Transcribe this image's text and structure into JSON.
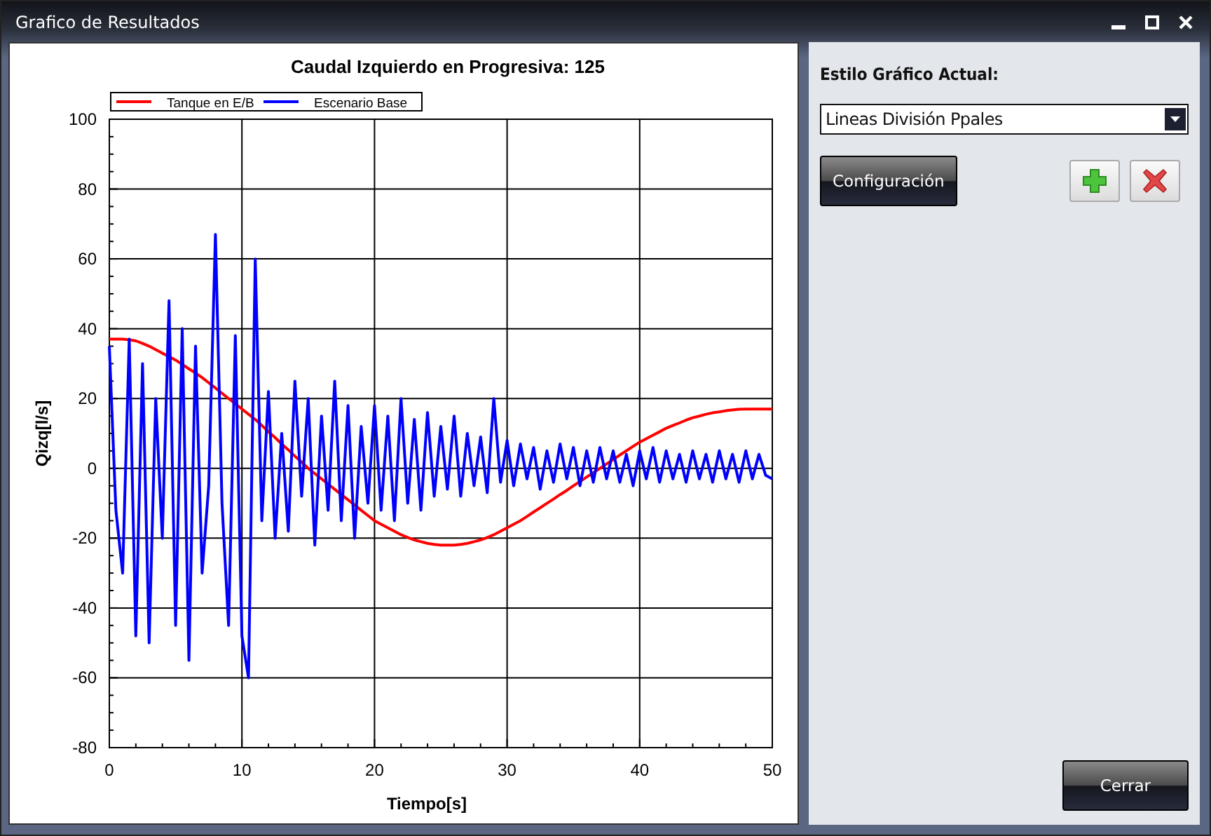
{
  "window": {
    "title": "Grafico de Resultados"
  },
  "chart": {
    "chart_data": {
      "type": "line",
      "title": "Caudal Izquierdo en Progresiva: 125",
      "xlabel": "Tiempo[s]",
      "ylabel": "Qizq[l/s]",
      "grid": true,
      "legend": true,
      "xlim": [
        0,
        50
      ],
      "ylim": [
        -80,
        100
      ],
      "xticks": [
        0,
        10,
        20,
        30,
        40,
        50
      ],
      "yticks": [
        -80,
        -60,
        -40,
        -20,
        0,
        20,
        40,
        60,
        80,
        100
      ],
      "x": [
        0,
        0.5,
        1,
        1.5,
        2,
        2.5,
        3,
        3.5,
        4,
        4.5,
        5,
        5.5,
        6,
        6.5,
        7,
        7.5,
        8,
        8.5,
        9,
        9.5,
        10,
        10.5,
        11,
        11.5,
        12,
        12.5,
        13,
        13.5,
        14,
        14.5,
        15,
        15.5,
        16,
        16.5,
        17,
        17.5,
        18,
        18.5,
        19,
        19.5,
        20,
        20.5,
        21,
        21.5,
        22,
        22.5,
        23,
        23.5,
        24,
        24.5,
        25,
        25.5,
        26,
        26.5,
        27,
        27.5,
        28,
        28.5,
        29,
        29.5,
        30,
        30.5,
        31,
        31.5,
        32,
        32.5,
        33,
        33.5,
        34,
        34.5,
        35,
        35.5,
        36,
        36.5,
        37,
        37.5,
        38,
        38.5,
        39,
        39.5,
        40,
        40.5,
        41,
        41.5,
        42,
        42.5,
        43,
        43.5,
        44,
        44.5,
        45,
        45.5,
        46,
        46.5,
        47,
        47.5,
        48,
        48.5,
        49,
        49.5,
        50
      ],
      "series": [
        {
          "name": "Tanque en E/B",
          "color": "#ff0000",
          "values": [
            37,
            37,
            37,
            36.8,
            36.5,
            35.8,
            35,
            34,
            33,
            32,
            31,
            29.8,
            28.5,
            27.3,
            26,
            24.5,
            23,
            21.5,
            20,
            18.5,
            17,
            15.5,
            14,
            12.3,
            10.5,
            8.8,
            7,
            5.3,
            3.5,
            1.8,
            0,
            -1.5,
            -3,
            -4.5,
            -6,
            -7.5,
            -9,
            -10.5,
            -12,
            -13.5,
            -15,
            -16,
            -17,
            -18,
            -19,
            -19.8,
            -20.5,
            -21,
            -21.5,
            -21.8,
            -22,
            -22,
            -22,
            -21.8,
            -21.5,
            -21,
            -20.5,
            -19.8,
            -19,
            -18,
            -17,
            -16,
            -15,
            -13.8,
            -12.5,
            -11.3,
            -10,
            -8.8,
            -7.5,
            -6.3,
            -5,
            -3.8,
            -2.5,
            -1.3,
            0,
            1.3,
            2.5,
            3.8,
            5,
            6.3,
            7.5,
            8.5,
            9.5,
            10.5,
            11.5,
            12.3,
            13,
            13.8,
            14.5,
            15,
            15.5,
            15.9,
            16.2,
            16.5,
            16.7,
            16.9,
            17,
            17,
            17,
            17,
            17
          ]
        },
        {
          "name": "Escenario Base",
          "color": "#0000ff",
          "values": [
            35,
            -12,
            -30,
            37,
            -48,
            30,
            -50,
            20,
            -20,
            48,
            -45,
            40,
            -55,
            35,
            -30,
            -5,
            67,
            -10,
            -45,
            38,
            -48,
            -60,
            60,
            -15,
            22,
            -20,
            10,
            -18,
            25,
            -8,
            20,
            -22,
            15,
            -12,
            25,
            -15,
            18,
            -20,
            12,
            -10,
            18,
            -12,
            15,
            -15,
            20,
            -10,
            14,
            -12,
            16,
            -8,
            12,
            -6,
            15,
            -8,
            10,
            -5,
            9,
            -7,
            20,
            -4,
            8,
            -5,
            7,
            -3,
            6,
            -6,
            5,
            -4,
            7,
            -3,
            6,
            -5,
            5,
            -4,
            6,
            -3,
            5,
            -4,
            4,
            -5,
            5,
            -3,
            6,
            -4,
            5,
            -3,
            4,
            -4,
            5,
            -3,
            4,
            -4,
            5,
            -3,
            4,
            -4,
            5,
            -3,
            4,
            -2,
            -3
          ]
        }
      ]
    }
  },
  "style_panel": {
    "label": "Estilo Gráfico Actual:",
    "style_select": {
      "value": "Lineas División Ppales"
    },
    "buttons": [
      {
        "kind": "text",
        "label": "Configuración"
      },
      {
        "kind": "add"
      },
      {
        "kind": "delete"
      }
    ]
  },
  "footer": {
    "close_button": "Cerrar"
  }
}
